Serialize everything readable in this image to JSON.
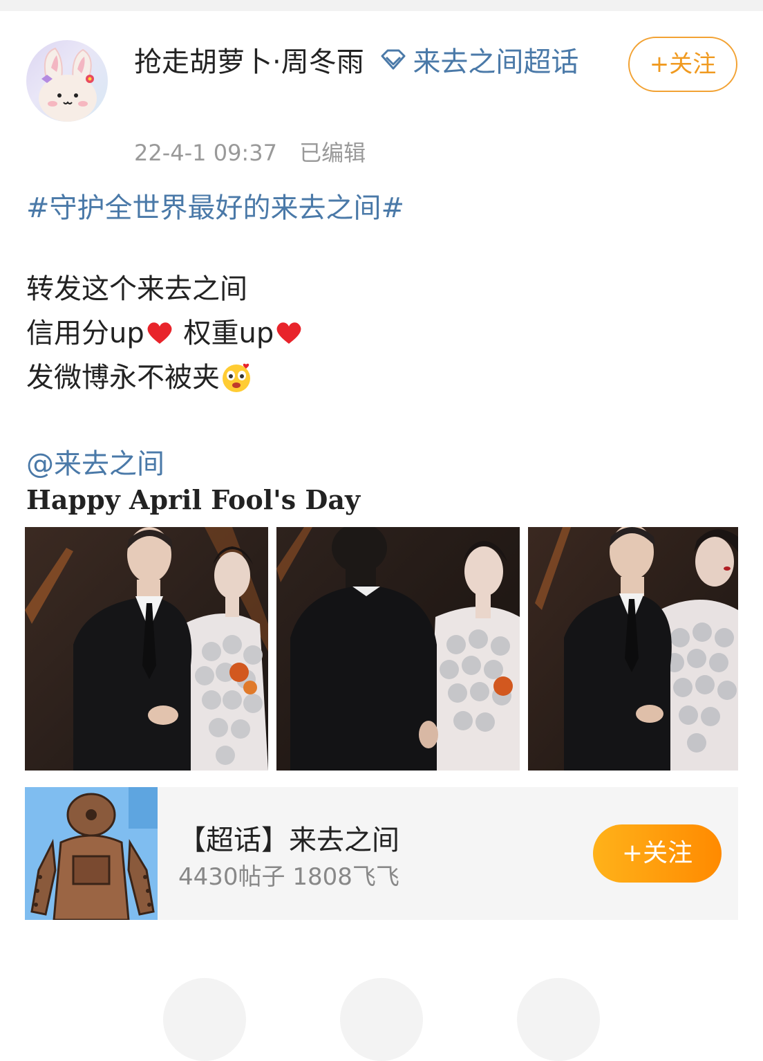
{
  "post": {
    "author": "抢走胡萝卜·周冬雨",
    "super_topic": "来去之间超话",
    "timestamp": "22-4-1 09:37",
    "edited_label": "已编辑",
    "follow_label": "+关注",
    "hashtag": "#守护全世界最好的来去之间#",
    "lines": {
      "line1": "转发这个来去之间",
      "line2a": "信用分up",
      "line2b": " 权重up",
      "line3": "发微博永不被夹"
    },
    "mention": "@来去之间",
    "caption": "Happy April Fool's Day",
    "images": [
      {
        "subject": "man-in-suit-and-woman-in-sequin-dress"
      },
      {
        "subject": "man-back-view-and-woman-smiling"
      },
      {
        "subject": "man-profile-and-woman-in-sequin-dress"
      }
    ]
  },
  "topic_card": {
    "title": "【超话】来去之间",
    "stats": "4430帖子 1808飞飞",
    "follow_label": "+关注"
  },
  "icons": {
    "diamond": "super-topic-diamond-icon",
    "heart": "red-heart-emoji",
    "emoji": "love-struck-face-emoji"
  },
  "colors": {
    "link": "#4a79a8",
    "accent_orange": "#f09a20",
    "meta_gray": "#999999"
  }
}
